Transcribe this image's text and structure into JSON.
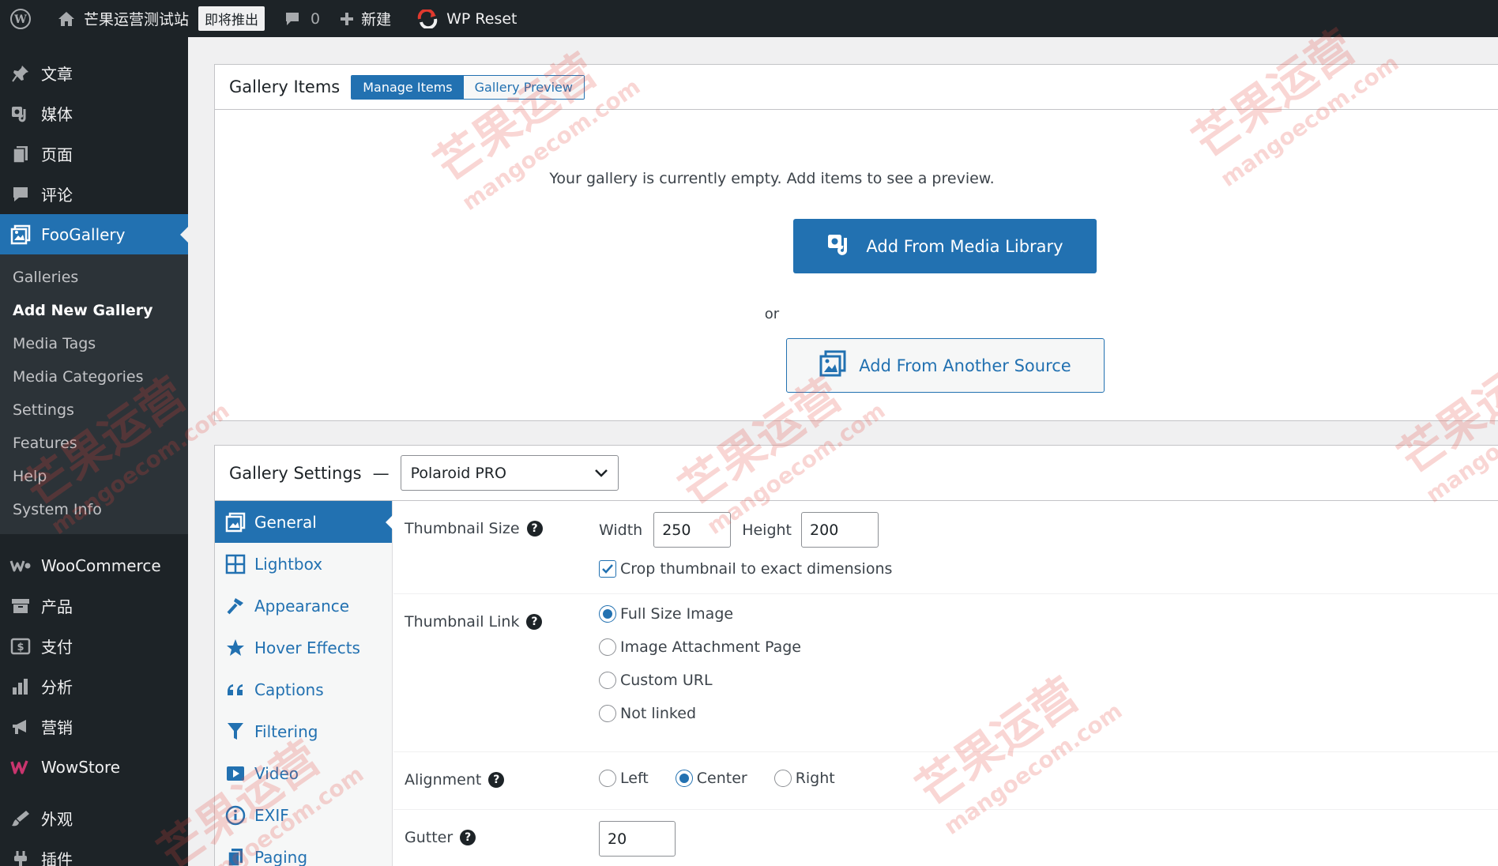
{
  "admin_bar": {
    "site_name": "芒果运营测试站",
    "coming_soon": "即将推出",
    "comments_count": "0",
    "new_label": "新建",
    "wp_reset_label": "WP Reset"
  },
  "sidebar": {
    "items_top": [
      {
        "label": "文章",
        "icon": "pushpin-icon"
      },
      {
        "label": "媒体",
        "icon": "media-icon"
      },
      {
        "label": "页面",
        "icon": "page-icon"
      },
      {
        "label": "评论",
        "icon": "comment-icon"
      }
    ],
    "foogallery": {
      "label": "FooGallery",
      "icon": "gallery-icon"
    },
    "submenu": [
      "Galleries",
      "Add New Gallery",
      "Media Tags",
      "Media Categories",
      "Settings",
      "Features",
      "Help",
      "System Info"
    ],
    "items_bottom": [
      {
        "label": "WooCommerce",
        "icon": "woocommerce-icon"
      },
      {
        "label": "产品",
        "icon": "archive-icon"
      },
      {
        "label": "支付",
        "icon": "payment-icon"
      },
      {
        "label": "分析",
        "icon": "bar-chart-icon"
      },
      {
        "label": "营销",
        "icon": "megaphone-icon"
      },
      {
        "label": "WowStore",
        "icon": "wowstore-icon"
      },
      {
        "label": "外观",
        "icon": "brush-icon"
      },
      {
        "label": "插件",
        "icon": "plugin-icon"
      }
    ]
  },
  "gallery_items": {
    "title": "Gallery Items",
    "tab_manage": "Manage Items",
    "tab_preview": "Gallery Preview",
    "empty_message": "Your gallery is currently empty. Add items to see a preview.",
    "add_media_library": "Add From Media Library",
    "or": "or",
    "add_another_source": "Add From Another Source"
  },
  "gallery_settings": {
    "title": "Gallery Settings",
    "dash": "—",
    "template": "Polaroid PRO",
    "tabs": [
      {
        "label": "General",
        "icon": "general-icon"
      },
      {
        "label": "Lightbox",
        "icon": "lightbox-grid-icon"
      },
      {
        "label": "Appearance",
        "icon": "appearance-hammer-icon"
      },
      {
        "label": "Hover Effects",
        "icon": "star-icon"
      },
      {
        "label": "Captions",
        "icon": "quote-icon"
      },
      {
        "label": "Filtering",
        "icon": "filter-icon"
      },
      {
        "label": "Video",
        "icon": "video-icon"
      },
      {
        "label": "EXIF",
        "icon": "info-icon"
      },
      {
        "label": "Paging",
        "icon": "paging-icon"
      }
    ],
    "thumbnail_size": {
      "label": "Thumbnail Size",
      "width_label": "Width",
      "width": "250",
      "height_label": "Height",
      "height": "200",
      "crop_label": "Crop thumbnail to exact dimensions",
      "crop_checked": true
    },
    "thumbnail_link": {
      "label": "Thumbnail Link",
      "options": [
        "Full Size Image",
        "Image Attachment Page",
        "Custom URL",
        "Not linked"
      ],
      "selected": "Full Size Image"
    },
    "alignment": {
      "label": "Alignment",
      "options": [
        "Left",
        "Center",
        "Right"
      ],
      "selected": "Center"
    },
    "gutter": {
      "label": "Gutter",
      "value": "20"
    }
  },
  "watermark": {
    "text": "芒果运营",
    "url": "mangoecom.com"
  },
  "colors": {
    "admin_bar_bg": "#1d2327",
    "accent": "#2271b1",
    "watermark": "#e4463c"
  }
}
